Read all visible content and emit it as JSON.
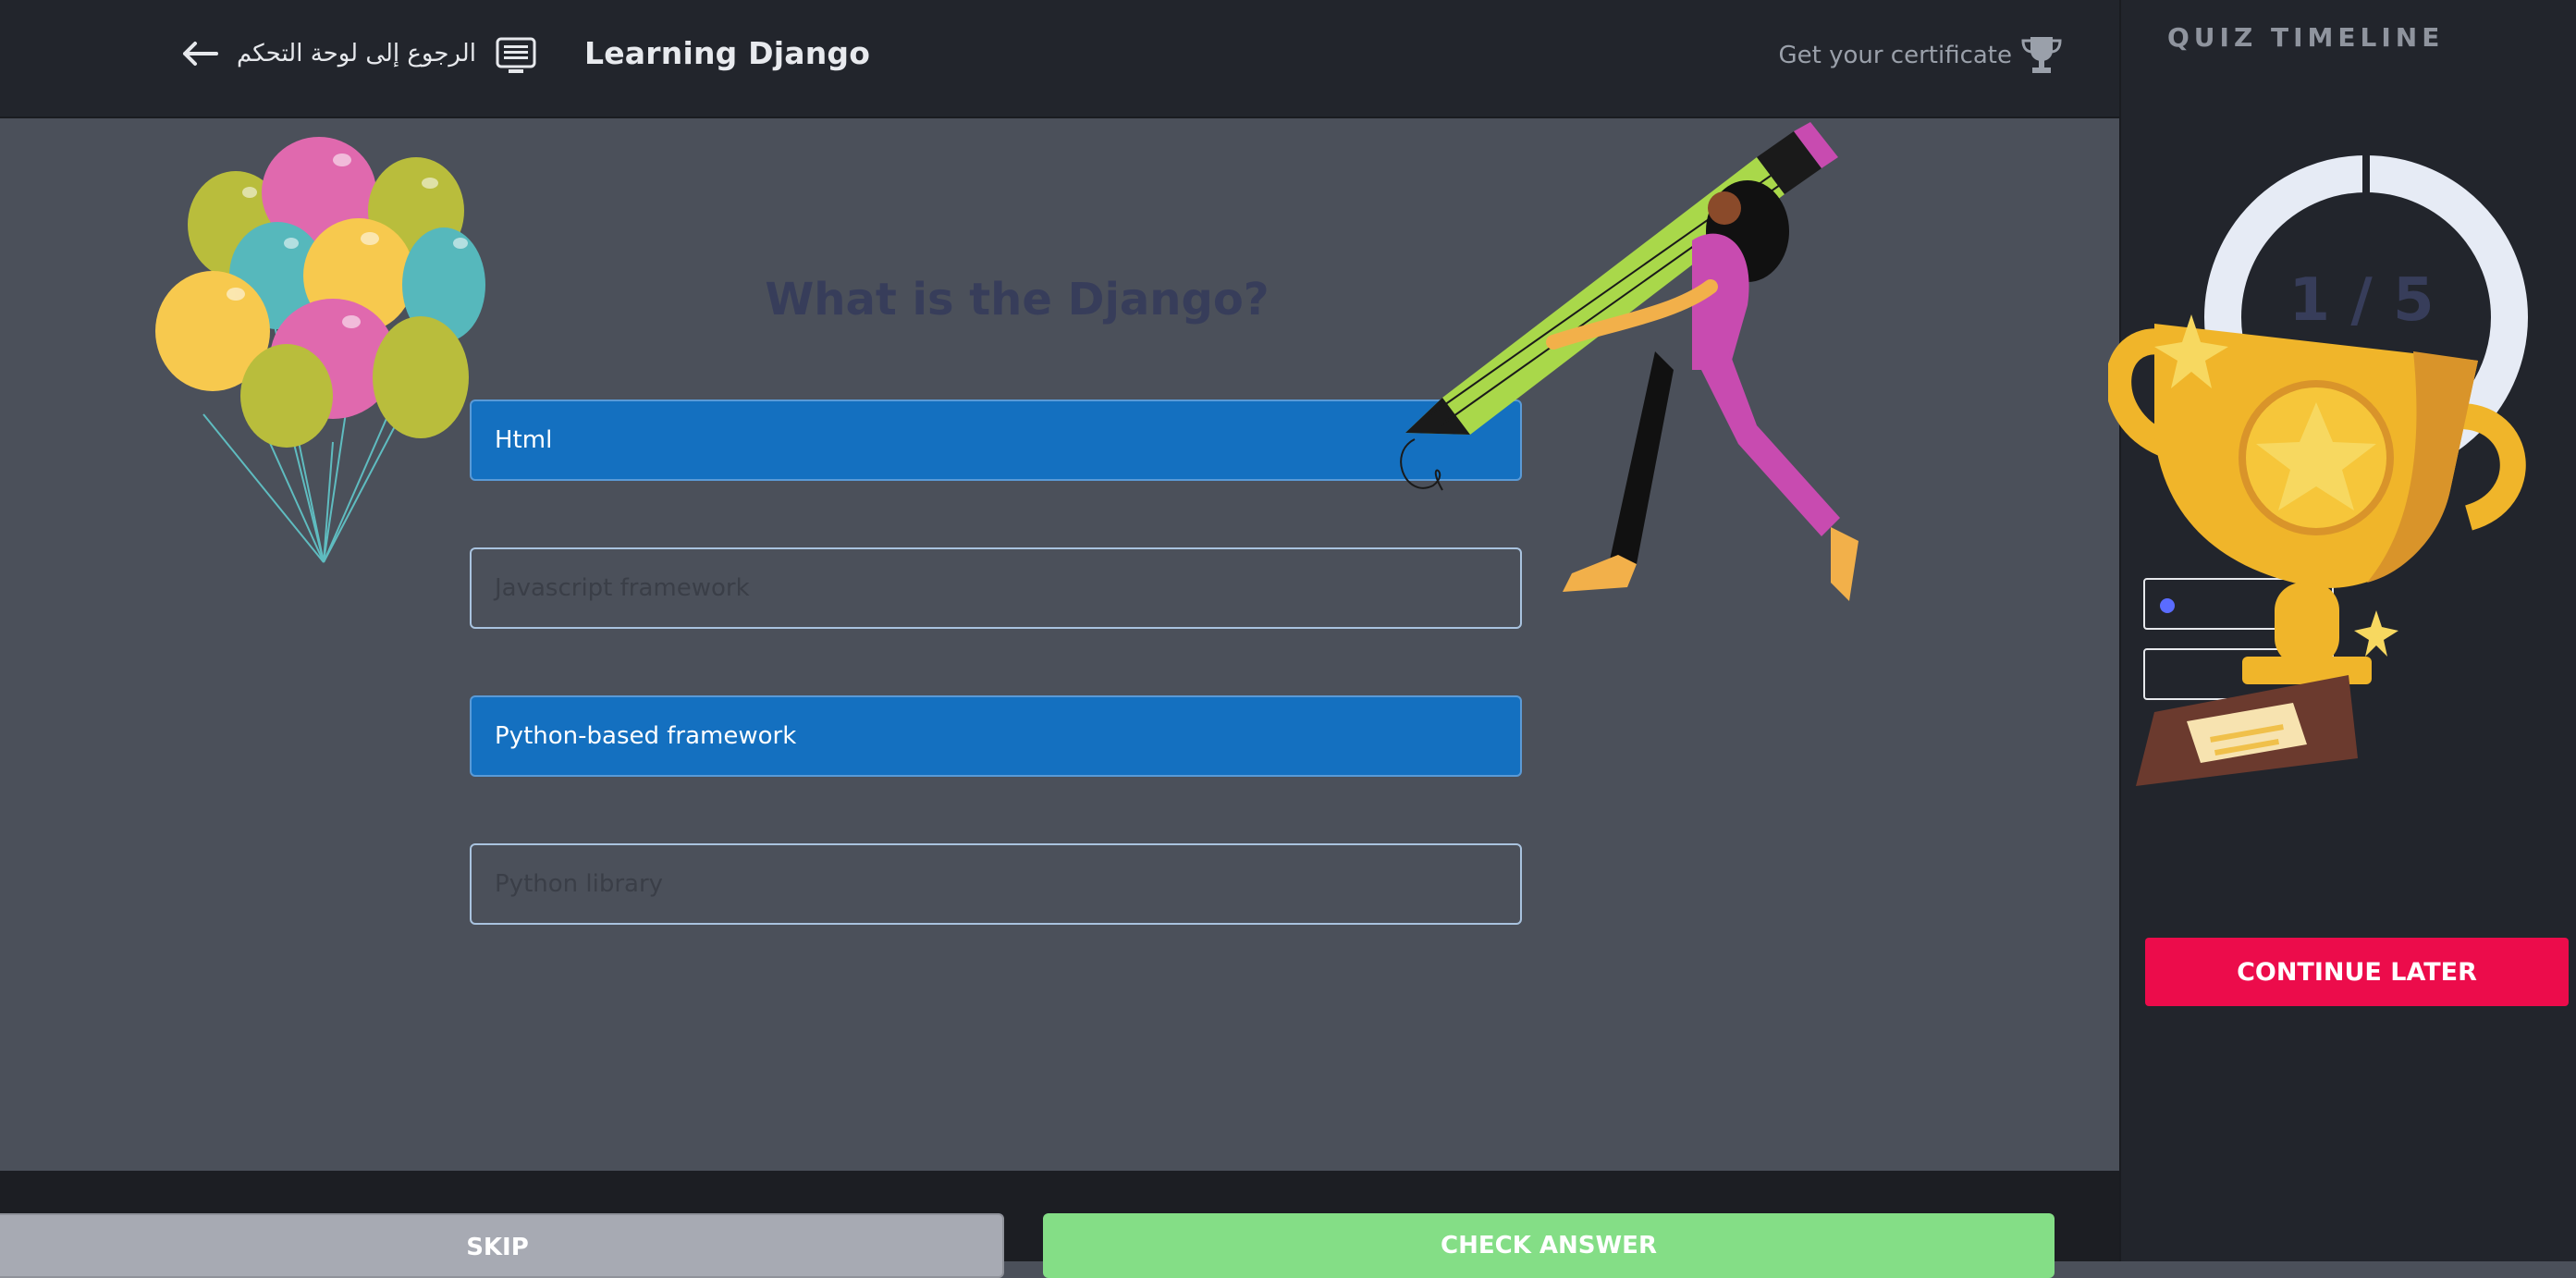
{
  "header": {
    "back_label": "الرجوع إلى لوحة التحكم",
    "course_title": "Learning Django",
    "certificate_label": "Get your certificate",
    "icons": {
      "back": "arrow-left-icon",
      "course": "list-icon",
      "certificate": "trophy-icon"
    }
  },
  "quiz": {
    "question": "What is the Django?",
    "options": [
      {
        "label": "Html",
        "selected": true
      },
      {
        "label": "Javascript framework",
        "selected": false
      },
      {
        "label": "Python-based framework",
        "selected": true
      },
      {
        "label": "Python library",
        "selected": false
      }
    ]
  },
  "footer": {
    "skip_label": "SKIP",
    "check_label": "CHECK ANSWER"
  },
  "timeline": {
    "title": "QUIZ TIMELINE",
    "progress_text": "1 / 5",
    "progress_current": 1,
    "progress_total": 5,
    "continue_label": "CONTINUE LATER"
  },
  "colors": {
    "selected_option": "#1470c0",
    "check_button": "#84de86",
    "continue_button": "#ec0c4b",
    "skip_button": "#a7aab3"
  }
}
